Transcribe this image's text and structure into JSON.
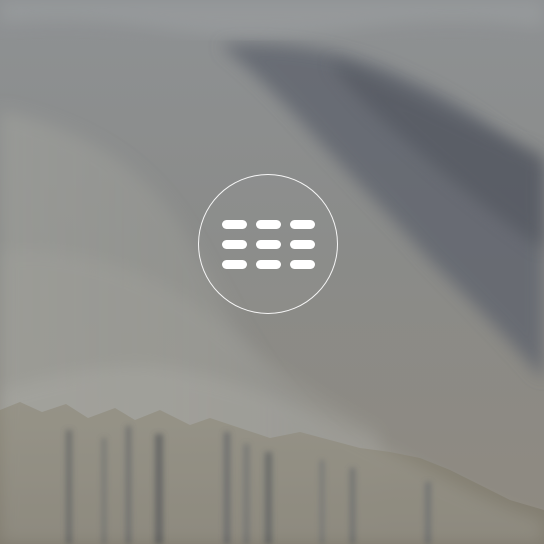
{
  "screen": {
    "background_description_color": "#8b8c8d",
    "launcher": {
      "icon": "app-grid-icon",
      "icon_color": "#ffffff",
      "ring_color": "#ffffff"
    }
  }
}
